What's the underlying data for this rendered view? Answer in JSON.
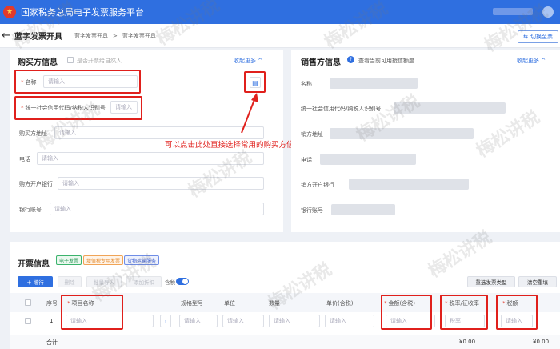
{
  "header": {
    "app_title": "国家税务总局电子发票服务平台"
  },
  "breadcrumb": {
    "title": "蓝字发票开具",
    "items": [
      "蓝字发票开具",
      "蓝字发票开具"
    ],
    "separator": ">"
  },
  "switch_button": "切换至票",
  "buyer": {
    "title": "购买方信息",
    "natural_person": "是否开票给自然人",
    "collapse": "收起更多",
    "fields": {
      "name": {
        "label": "名称",
        "placeholder": "请输入"
      },
      "taxid": {
        "label": "统一社会信用代码/纳税人识别号",
        "placeholder": "请输入"
      },
      "address": {
        "label": "购买方地址",
        "placeholder": "请输入"
      },
      "phone": {
        "label": "电话",
        "placeholder": "请输入"
      },
      "bank": {
        "label": "购方开户银行",
        "placeholder": "请输入"
      },
      "account": {
        "label": "银行账号",
        "placeholder": "请输入"
      }
    }
  },
  "seller": {
    "title": "销售方信息",
    "credit_link": "查看当前可用授信额度",
    "collapse": "收起更多",
    "fields": [
      "名称",
      "统一社会信用代码/纳税人识别号",
      "销方地址",
      "电话",
      "销方开户银行",
      "银行账号"
    ]
  },
  "annotation": "可以点击此处直接选择常用的购买方信息",
  "invoice": {
    "title": "开票信息",
    "tags": [
      "电子发票",
      "增值税专用发票",
      "货物运输服务"
    ],
    "buttons": {
      "add": "＋ 增行",
      "delete": "删除",
      "import": "批量导入",
      "discount": "添加折扣",
      "tax_included": "含税",
      "reselect": "重选发票类型",
      "clear": "清空重填"
    },
    "columns": [
      "序号",
      "项目名称",
      "规格型号",
      "单位",
      "数量",
      "单价(含税)",
      "金额(含税)",
      "税率/征收率",
      "税额"
    ],
    "row": {
      "index": "1",
      "placeholder": "请输入",
      "tax_rate_placeholder": "税率"
    },
    "total_label": "合计",
    "total_amount": "¥0.00",
    "total_tax": "¥0.00"
  },
  "watermark": "梅松讲税",
  "colors": {
    "brand": "#2f6fe0",
    "annotation": "#e0201c"
  }
}
